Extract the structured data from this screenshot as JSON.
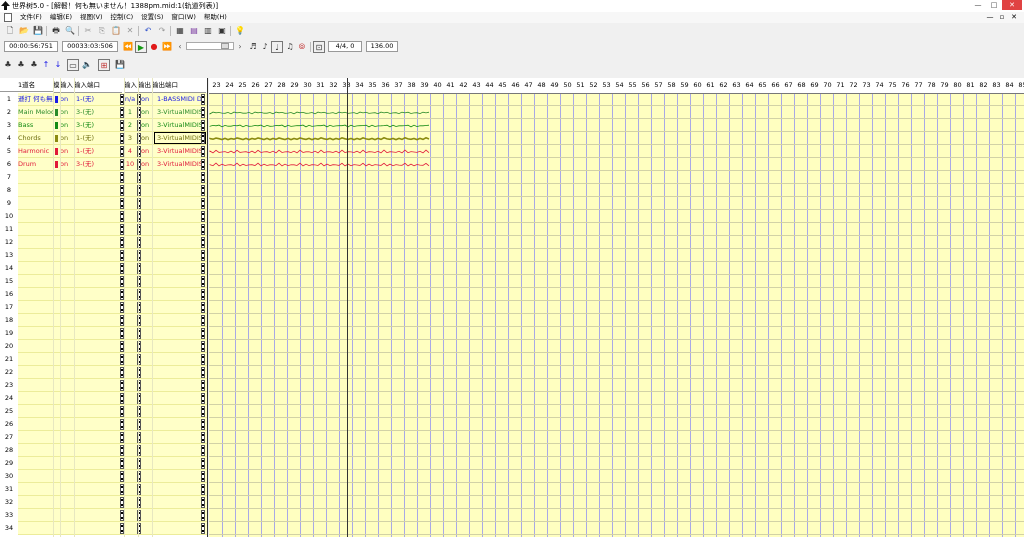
{
  "window": {
    "title": "世界树5.0 - [解髫！何も無いません！1388pm.mid:1(轨道列表)]",
    "minimize": "—",
    "maximize": "□",
    "close": "✕"
  },
  "menu": {
    "items": [
      "文件(F)",
      "编辑(E)",
      "视图(V)",
      "控制(C)",
      "设置(S)",
      "窗口(W)",
      "帮助(H)"
    ],
    "mdi": [
      "—",
      "▫",
      "✕"
    ]
  },
  "transport": {
    "time": "00:00:56:751",
    "position": "00033:03:506",
    "time_signature": "4/4, 0",
    "tempo": "136.00"
  },
  "tracklist": {
    "headers": {
      "track_name": "1道名",
      "mode": "摸",
      "input": "输入",
      "input_port": "输入端口",
      "input_ch": "输入",
      "output": "输出",
      "output_port": "输出端口"
    },
    "rows": [
      {
        "num": "1",
        "name": "遜打 何も無",
        "color": "#1a1ae6",
        "text_color": "#1a1ae6",
        "mode": "on",
        "in_port": "1-(无)",
        "ch": "n/a",
        "out": "on",
        "out_port": "1-BASSMIDI D"
      },
      {
        "num": "2",
        "name": "Main Melody",
        "color": "#2a8a2a",
        "text_color": "#2a8a2a",
        "mode": "on",
        "in_port": "3-(无)",
        "ch": "1",
        "out": "on",
        "out_port": "3-VirtualMIDIS"
      },
      {
        "num": "3",
        "name": "Bass",
        "color": "#138a13",
        "text_color": "#138a13",
        "mode": "on",
        "in_port": "3-(无)",
        "ch": "2",
        "out": "on",
        "out_port": "3-VirtualMIDIS"
      },
      {
        "num": "4",
        "name": "Chords",
        "color": "#8a8a10",
        "text_color": "#6f6f10",
        "mode": "on",
        "in_port": "1-(无)",
        "ch": "3",
        "out": "on",
        "out_port": "3-VirtualMIDIS"
      },
      {
        "num": "5",
        "name": "Harmonic",
        "color": "#e01a3a",
        "text_color": "#e01a3a",
        "mode": "on",
        "in_port": "1-(无)",
        "ch": "4",
        "out": "on",
        "out_port": "3-VirtualMIDIS"
      },
      {
        "num": "6",
        "name": "Drum",
        "color": "#e01a3a",
        "text_color": "#e01a3a",
        "mode": "on",
        "in_port": "3-(无)",
        "ch": "10",
        "out": "on",
        "out_port": "3-VirtualMIDIS"
      }
    ],
    "row_count": 34
  },
  "ruler": {
    "first_measure": 23,
    "last_measure": 85
  },
  "icons": {
    "toolbar1": [
      "new-file-icon",
      "open-folder-icon",
      "save-icon",
      "print-icon",
      "print-preview-icon",
      "cut-icon",
      "copy-icon",
      "paste-icon",
      "delete-icon",
      "undo-icon",
      "redo-icon",
      "track-list-view-icon",
      "piano-roll-icon",
      "event-list-icon",
      "tempo-view-icon",
      "help-icon"
    ],
    "toolbar3": [
      "track-add-icon",
      "track-insert-icon",
      "track-delete-icon",
      "move-up-icon",
      "move-down-icon",
      "track-select-icon",
      "metronome-icon",
      "record-mode-icon",
      "save-track-icon"
    ]
  }
}
